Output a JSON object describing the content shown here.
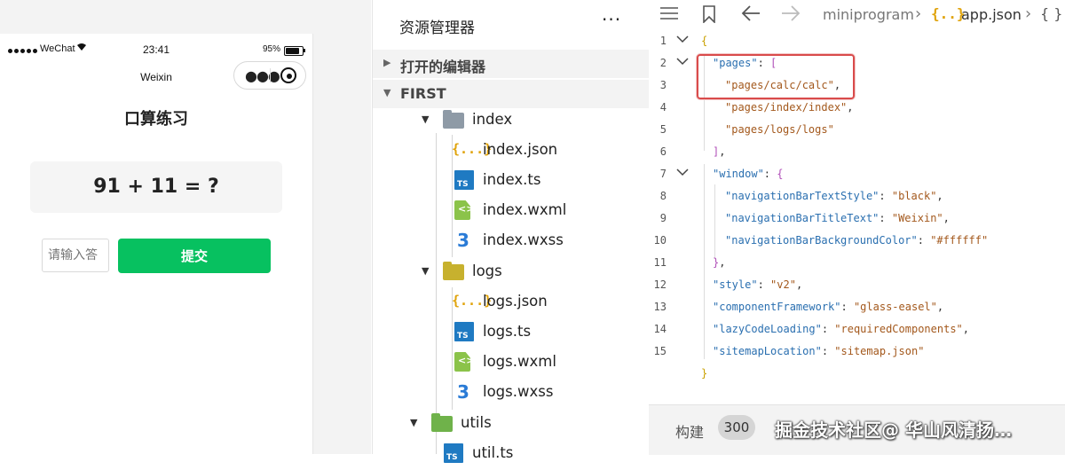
{
  "simulator": {
    "status": {
      "carrier": "WeChat",
      "time": "23:41",
      "battery": "95%",
      "battery_level": 0.95
    },
    "nav_title": "Weixin",
    "page_title": "口算练习",
    "question": "91 + 11 = ?",
    "answer_placeholder": "请输入答",
    "submit_label": "提交"
  },
  "explorer": {
    "title": "资源管理器",
    "more": "···",
    "sections": {
      "open_editors": "打开的编辑器",
      "project": "FIRST"
    },
    "folders": {
      "index": "index",
      "logs": "logs",
      "utils": "utils"
    },
    "files": {
      "index_json": "index.json",
      "index_ts": "index.ts",
      "index_wxml": "index.wxml",
      "index_wxss": "index.wxss",
      "logs_json": "logs.json",
      "logs_ts": "logs.ts",
      "logs_wxml": "logs.wxml",
      "logs_wxss": "logs.wxss",
      "util_ts": "util.ts"
    },
    "icons": {
      "json": "{...}",
      "ts": "TS",
      "wxml": "<>",
      "wxss": "3"
    }
  },
  "editor": {
    "breadcrumb": [
      "miniprogram",
      "app.json"
    ],
    "crumb_tail": "{ }",
    "json_icon": "{..}",
    "line_numbers": [
      "1",
      "2",
      "3",
      "4",
      "5",
      "6",
      "7",
      "8",
      "9",
      "10",
      "11",
      "12",
      "13",
      "14",
      "15"
    ],
    "code": {
      "open_brace": "{",
      "pages_key": "\"pages\"",
      "pages_open": "[",
      "page1": "\"pages/calc/calc\"",
      "page2": "\"pages/index/index\"",
      "page3": "\"pages/logs/logs\"",
      "pages_close": "]",
      "window_key": "\"window\"",
      "window_open": "{",
      "nbts_key": "\"navigationBarTextStyle\"",
      "nbts_val": "\"black\"",
      "nbtt_key": "\"navigationBarTitleText\"",
      "nbtt_val": "\"Weixin\"",
      "nbbc_key": "\"navigationBarBackgroundColor\"",
      "nbbc_val": "\"#ffffff\"",
      "window_close": "}",
      "style_key": "\"style\"",
      "style_val": "\"v2\"",
      "cf_key": "\"componentFramework\"",
      "cf_val": "\"glass-easel\"",
      "lcl_key": "\"lazyCodeLoading\"",
      "lcl_val": "\"requiredComponents\"",
      "sl_key": "\"sitemapLocation\"",
      "sl_val": "\"sitemap.json\"",
      "close_brace": "}"
    },
    "bottom": {
      "build_label": "构建",
      "build_count": "300"
    },
    "watermark": "掘金技术社区@ 华山风清扬…"
  },
  "colors": {
    "accent_green": "#07c160",
    "highlight_red": "#d94b4b",
    "json_key": "#2a6fb0",
    "json_string": "#a3581c"
  }
}
